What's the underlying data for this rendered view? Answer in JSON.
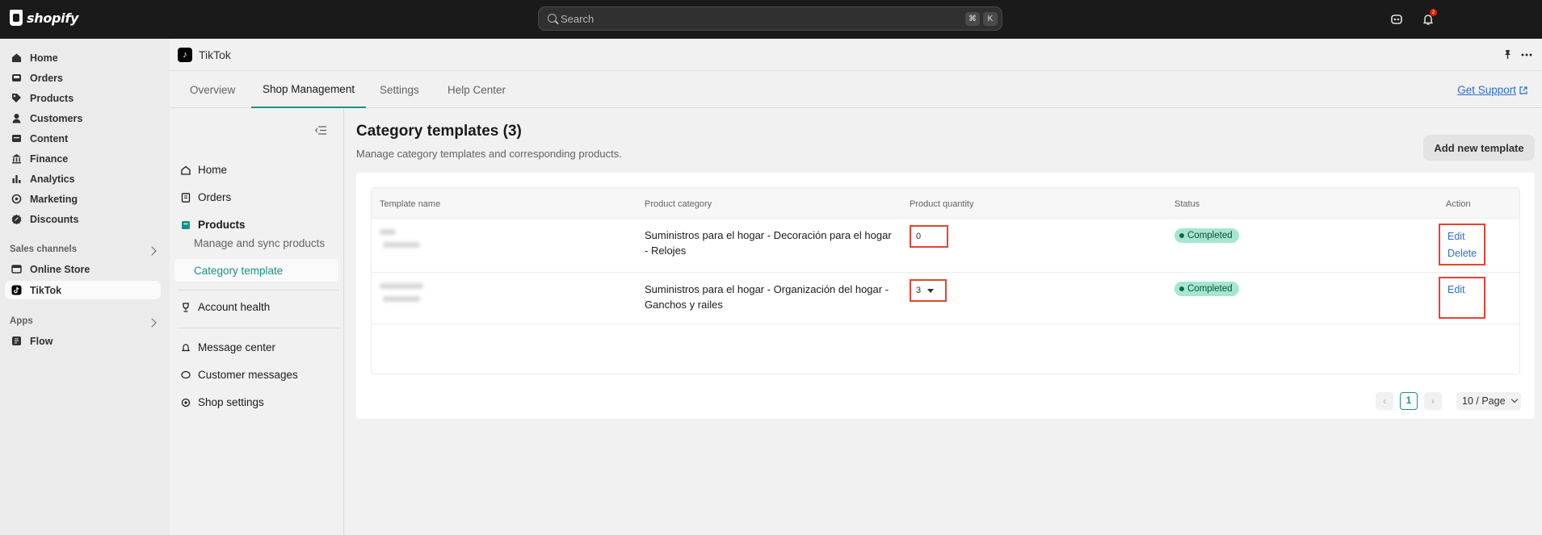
{
  "topbar": {
    "logo_text": "shopify",
    "search_placeholder": "Search",
    "kbd_cmd": "⌘",
    "kbd_k": "K",
    "notification_count": "2"
  },
  "sidebar": {
    "items": [
      {
        "label": "Home",
        "icon": "home-icon"
      },
      {
        "label": "Orders",
        "icon": "inbox-icon"
      },
      {
        "label": "Products",
        "icon": "tag-icon"
      },
      {
        "label": "Customers",
        "icon": "person-icon"
      },
      {
        "label": "Content",
        "icon": "content-icon"
      },
      {
        "label": "Finance",
        "icon": "bank-icon"
      },
      {
        "label": "Analytics",
        "icon": "bar-chart-icon"
      },
      {
        "label": "Marketing",
        "icon": "target-icon"
      },
      {
        "label": "Discounts",
        "icon": "discount-icon"
      }
    ],
    "sales_channels_label": "Sales channels",
    "channels": [
      {
        "label": "Online Store",
        "icon": "store-icon"
      },
      {
        "label": "TikTok",
        "icon": "tiktok-icon"
      }
    ],
    "apps_label": "Apps",
    "apps": [
      {
        "label": "Flow",
        "icon": "flow-icon"
      }
    ]
  },
  "app": {
    "title": "TikTok",
    "tabs": [
      "Overview",
      "Shop Management",
      "Settings",
      "Help Center"
    ],
    "get_support": "Get Support"
  },
  "inner_nav": {
    "home": "Home",
    "orders": "Orders",
    "products": "Products",
    "manage_sync": "Manage and sync products",
    "category_template": "Category template",
    "account_health": "Account health",
    "message_center": "Message center",
    "customer_messages": "Customer messages",
    "shop_settings": "Shop settings"
  },
  "content": {
    "title": "Category templates (3)",
    "subtitle": "Manage category templates and corresponding products.",
    "add_button": "Add new template"
  },
  "table": {
    "columns": [
      "Template name",
      "Product category",
      "Product quantity",
      "Status",
      "Action"
    ],
    "rows": [
      {
        "category_line1": "Suministros para el hogar - Decoración para el hogar",
        "category_line2": "- Relojes",
        "quantity": "0",
        "status": "Completed",
        "actions": [
          "Edit",
          "Delete"
        ]
      },
      {
        "category_line1": "Suministros para el hogar - Organización del hogar -",
        "category_line2": "Ganchos y railes",
        "quantity": "3",
        "status": "Completed",
        "actions": [
          "Edit"
        ]
      }
    ]
  },
  "pagination": {
    "prev": "‹",
    "current_page": "1",
    "next": "›",
    "page_size": "10 / Page"
  },
  "colors": {
    "accent": "#19917f",
    "link": "#2c6ecb",
    "highlight": "#e8432e",
    "status_bg": "#a6e6cf"
  }
}
